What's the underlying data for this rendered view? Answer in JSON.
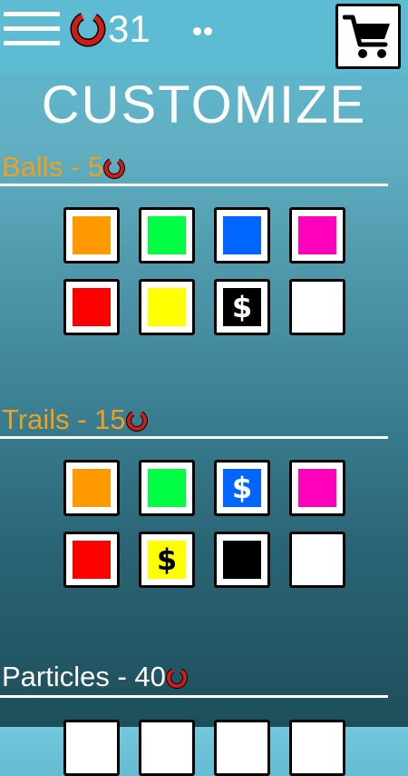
{
  "header": {
    "coins": "31",
    "menu_icon": "hamburger-menu-icon",
    "coin_icon": "coin-icon",
    "cart_icon": "shopping-cart-icon",
    "more_icon": "dots-icon"
  },
  "title": "CUSTOMIZE",
  "sections": [
    {
      "label": "Balls - 5",
      "label_color": "#f0a020",
      "swatches": [
        {
          "color": "#ff9900",
          "locked": false
        },
        {
          "color": "#00ff44",
          "locked": false
        },
        {
          "color": "#0066ff",
          "locked": false
        },
        {
          "color": "#ff00bb",
          "locked": false
        },
        {
          "color": "#ff0000",
          "locked": false
        },
        {
          "color": "#ffff00",
          "locked": false
        },
        {
          "color": "#000000",
          "locked": true,
          "price_symbol": "$"
        },
        {
          "color": "#ffffff",
          "locked": false
        }
      ]
    },
    {
      "label": "Trails - 15",
      "label_color": "#f0a020",
      "swatches": [
        {
          "color": "#ff9900",
          "locked": false
        },
        {
          "color": "#00ff44",
          "locked": false
        },
        {
          "color": "#0066ff",
          "locked": true,
          "price_symbol": "$"
        },
        {
          "color": "#ff00bb",
          "locked": false
        },
        {
          "color": "#ff0000",
          "locked": false
        },
        {
          "color": "#ffff00",
          "locked": true,
          "price_symbol": "$"
        },
        {
          "color": "#000000",
          "locked": false
        },
        {
          "color": "#ffffff",
          "locked": false
        }
      ]
    },
    {
      "label": "Particles - 40",
      "label_color": "#ffffff",
      "swatches": []
    }
  ],
  "colors": {
    "coin_red": "#d11a1a",
    "topbar_bg": "#5dbbd3"
  }
}
